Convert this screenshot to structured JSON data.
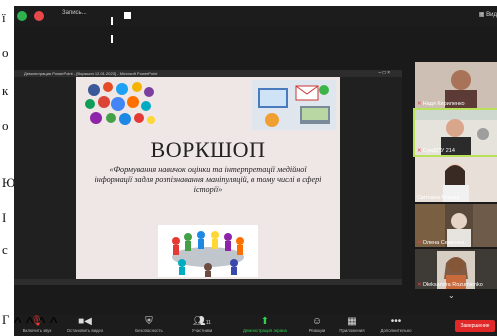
{
  "left_margin": {
    "letters": [
      "ї",
      "о",
      "к",
      "о",
      "Ю",
      "І",
      "с",
      "Г"
    ]
  },
  "topbar": {
    "recording_label": "Запись...",
    "view_label": "Вид",
    "colors": {
      "rec": "#e8484a",
      "secure": "#2fb14c"
    }
  },
  "shared_window": {
    "title": "Демонстрация PowerPoint - [Воркшоп 12.01.2023] - Microsoft PowerPoint",
    "controls": "–  □  ×"
  },
  "slide": {
    "title": "ВОРКШОП",
    "subtitle": "«Формування навичок оцінки та інтерпретації медійної інформації задля розпізнавання маніпуляцій, в тому числі в сфері історії»"
  },
  "participants": [
    {
      "name": "Надя Кириленко",
      "muted": true
    },
    {
      "name": "СумДПУ 214",
      "muted": true,
      "active": true
    },
    {
      "name": "Світлана Мошак",
      "muted": false
    },
    {
      "name": "Олена Семенюк",
      "muted": true
    },
    {
      "name": "Oleksandra Rozumienko",
      "muted": true
    }
  ],
  "toolbar": {
    "items": [
      {
        "label": "Включить звук",
        "icon": "mic-muted-icon"
      },
      {
        "label": "Остановить видео",
        "icon": "video-icon"
      },
      {
        "label": "Безопасность",
        "icon": "shield-icon"
      },
      {
        "label": "Участники",
        "icon": "participants-icon",
        "count": "11"
      },
      {
        "label": "Демонстрация экрана",
        "icon": "share-screen-icon"
      },
      {
        "label": "Реакции",
        "icon": "reactions-icon"
      },
      {
        "label": "Приложения",
        "icon": "apps-icon"
      },
      {
        "label": "Дополнительно",
        "icon": "more-icon"
      }
    ],
    "end_label": "Завершение",
    "accent": "#2fd04c"
  }
}
